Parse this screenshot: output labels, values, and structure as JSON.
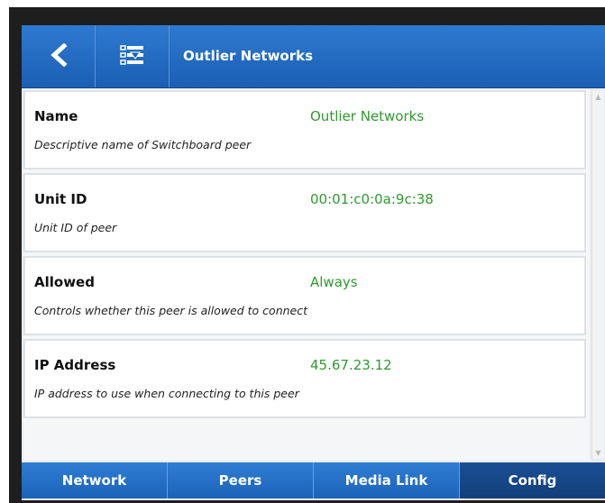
{
  "header": {
    "title": "Outlier Networks",
    "back_icon": "chevron-left-icon",
    "sync_icon": "download-list-icon"
  },
  "fields": [
    {
      "name": "Name",
      "value": "Outlier Networks",
      "description": "Descriptive name of Switchboard peer"
    },
    {
      "name": "Unit ID",
      "value": "00:01:c0:0a:9c:38",
      "description": "Unit ID of peer"
    },
    {
      "name": "Allowed",
      "value": "Always",
      "description": "Controls whether this peer is allowed to connect"
    },
    {
      "name": "IP Address",
      "value": "45.67.23.12",
      "description": "IP address to use when connecting to this peer"
    }
  ],
  "nav": {
    "tabs": [
      {
        "label": "Network"
      },
      {
        "label": "Peers"
      },
      {
        "label": "Media Link"
      },
      {
        "label": "Config"
      }
    ],
    "active": "Config"
  },
  "colors": {
    "header_blue": "#1a5fb4",
    "value_green": "#2e9a2e",
    "active_tab": "#123f7a"
  }
}
